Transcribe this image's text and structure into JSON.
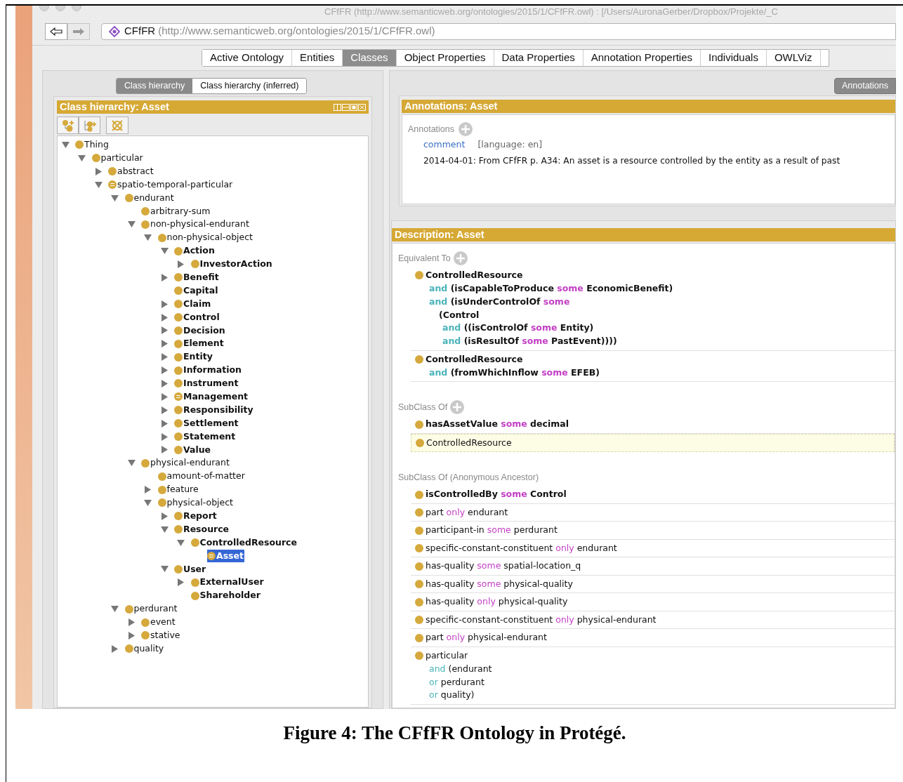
{
  "window": {
    "title": "CFfFR (http://www.semanticweb.org/ontologies/2015/1/CFfFR.owl)  : [/Users/AuronaGerber/Dropbox/Projekte/_C"
  },
  "address": {
    "name": "CFfFR",
    "iri": "(http://www.semanticweb.org/ontologies/2015/1/CFfFR.owl)"
  },
  "tabs": [
    {
      "label": "Active Ontology",
      "selected": false
    },
    {
      "label": "Entities",
      "selected": false
    },
    {
      "label": "Classes",
      "selected": true
    },
    {
      "label": "Object Properties",
      "selected": false
    },
    {
      "label": "Data Properties",
      "selected": false
    },
    {
      "label": "Annotation Properties",
      "selected": false
    },
    {
      "label": "Individuals",
      "selected": false
    },
    {
      "label": "OWLViz",
      "selected": false
    }
  ],
  "class_hierarchy": {
    "view_tabs": [
      {
        "label": "Class hierarchy",
        "selected": true
      },
      {
        "label": "Class hierarchy (inferred)",
        "selected": false
      }
    ],
    "title": "Class hierarchy: Asset",
    "tree": [
      {
        "label": "Thing",
        "kind": "branch",
        "expanded": true,
        "bold": false,
        "defined": false,
        "selected": false,
        "children": [
          {
            "label": "particular",
            "kind": "branch",
            "expanded": true,
            "bold": false,
            "defined": false,
            "selected": false,
            "children": [
              {
                "label": "abstract",
                "kind": "branch",
                "expanded": false,
                "bold": false,
                "defined": false,
                "selected": false
              },
              {
                "label": "spatio-temporal-particular",
                "kind": "branch",
                "expanded": true,
                "bold": false,
                "defined": true,
                "selected": false,
                "children": [
                  {
                    "label": "endurant",
                    "kind": "branch",
                    "expanded": true,
                    "bold": false,
                    "defined": false,
                    "selected": false,
                    "children": [
                      {
                        "label": "arbitrary-sum",
                        "kind": "leaf",
                        "bold": false,
                        "defined": false,
                        "selected": false
                      },
                      {
                        "label": "non-physical-endurant",
                        "kind": "branch",
                        "expanded": true,
                        "bold": false,
                        "defined": false,
                        "selected": false,
                        "children": [
                          {
                            "label": "non-physical-object",
                            "kind": "branch",
                            "expanded": true,
                            "bold": false,
                            "defined": false,
                            "selected": false,
                            "children": [
                              {
                                "label": "Action",
                                "kind": "branch",
                                "expanded": true,
                                "bold": true,
                                "defined": false,
                                "selected": false,
                                "children": [
                                  {
                                    "label": "InvestorAction",
                                    "kind": "branch",
                                    "expanded": false,
                                    "bold": true,
                                    "defined": false,
                                    "selected": false
                                  }
                                ]
                              },
                              {
                                "label": "Benefit",
                                "kind": "branch",
                                "expanded": false,
                                "bold": true,
                                "defined": false,
                                "selected": false
                              },
                              {
                                "label": "Capital",
                                "kind": "leaf",
                                "bold": true,
                                "defined": false,
                                "selected": false
                              },
                              {
                                "label": "Claim",
                                "kind": "branch",
                                "expanded": false,
                                "bold": true,
                                "defined": false,
                                "selected": false
                              },
                              {
                                "label": "Control",
                                "kind": "branch",
                                "expanded": false,
                                "bold": true,
                                "defined": false,
                                "selected": false
                              },
                              {
                                "label": "Decision",
                                "kind": "branch",
                                "expanded": false,
                                "bold": true,
                                "defined": false,
                                "selected": false
                              },
                              {
                                "label": "Element",
                                "kind": "branch",
                                "expanded": false,
                                "bold": true,
                                "defined": false,
                                "selected": false
                              },
                              {
                                "label": "Entity",
                                "kind": "branch",
                                "expanded": false,
                                "bold": true,
                                "defined": false,
                                "selected": false
                              },
                              {
                                "label": "Information",
                                "kind": "branch",
                                "expanded": false,
                                "bold": true,
                                "defined": false,
                                "selected": false
                              },
                              {
                                "label": "Instrument",
                                "kind": "branch",
                                "expanded": false,
                                "bold": true,
                                "defined": false,
                                "selected": false
                              },
                              {
                                "label": "Management",
                                "kind": "branch",
                                "expanded": false,
                                "bold": true,
                                "defined": true,
                                "selected": false
                              },
                              {
                                "label": "Responsibility",
                                "kind": "branch",
                                "expanded": false,
                                "bold": true,
                                "defined": false,
                                "selected": false
                              },
                              {
                                "label": "Settlement",
                                "kind": "branch",
                                "expanded": false,
                                "bold": true,
                                "defined": false,
                                "selected": false
                              },
                              {
                                "label": "Statement",
                                "kind": "branch",
                                "expanded": false,
                                "bold": true,
                                "defined": false,
                                "selected": false
                              },
                              {
                                "label": "Value",
                                "kind": "branch",
                                "expanded": false,
                                "bold": true,
                                "defined": false,
                                "selected": false
                              }
                            ]
                          }
                        ]
                      },
                      {
                        "label": "physical-endurant",
                        "kind": "branch",
                        "expanded": true,
                        "bold": false,
                        "defined": false,
                        "selected": false,
                        "children": [
                          {
                            "label": "amount-of-matter",
                            "kind": "leaf",
                            "bold": false,
                            "defined": false,
                            "selected": false
                          },
                          {
                            "label": "feature",
                            "kind": "branch",
                            "expanded": false,
                            "bold": false,
                            "defined": false,
                            "selected": false
                          },
                          {
                            "label": "physical-object",
                            "kind": "branch",
                            "expanded": true,
                            "bold": false,
                            "defined": false,
                            "selected": false,
                            "children": [
                              {
                                "label": "Report",
                                "kind": "branch",
                                "expanded": false,
                                "bold": true,
                                "defined": false,
                                "selected": false
                              },
                              {
                                "label": "Resource",
                                "kind": "branch",
                                "expanded": true,
                                "bold": true,
                                "defined": false,
                                "selected": false,
                                "children": [
                                  {
                                    "label": "ControlledResource",
                                    "kind": "branch",
                                    "expanded": true,
                                    "bold": true,
                                    "defined": false,
                                    "selected": false,
                                    "children": [
                                      {
                                        "label": "Asset",
                                        "kind": "leaf",
                                        "bold": true,
                                        "defined": true,
                                        "selected": true
                                      }
                                    ]
                                  }
                                ]
                              },
                              {
                                "label": "User",
                                "kind": "branch",
                                "expanded": true,
                                "bold": true,
                                "defined": false,
                                "selected": false,
                                "children": [
                                  {
                                    "label": "ExternalUser",
                                    "kind": "branch",
                                    "expanded": false,
                                    "bold": true,
                                    "defined": false,
                                    "selected": false
                                  },
                                  {
                                    "label": "Shareholder",
                                    "kind": "leaf",
                                    "bold": true,
                                    "defined": false,
                                    "selected": false
                                  }
                                ]
                              }
                            ]
                          }
                        ]
                      }
                    ]
                  },
                  {
                    "label": "perdurant",
                    "kind": "branch",
                    "expanded": true,
                    "bold": false,
                    "defined": false,
                    "selected": false,
                    "children": [
                      {
                        "label": "event",
                        "kind": "branch",
                        "expanded": false,
                        "bold": false,
                        "defined": false,
                        "selected": false
                      },
                      {
                        "label": "stative",
                        "kind": "branch",
                        "expanded": false,
                        "bold": false,
                        "defined": false,
                        "selected": false
                      }
                    ]
                  },
                  {
                    "label": "quality",
                    "kind": "branch",
                    "expanded": false,
                    "bold": false,
                    "defined": false,
                    "selected": false
                  }
                ]
              }
            ]
          }
        ]
      }
    ]
  },
  "annotations": {
    "button": "Annotations",
    "title": "Annotations: Asset",
    "section_label": "Annotations",
    "items": [
      {
        "property": "comment",
        "language": "[language: en]",
        "value": "2014-04-01: From CFfFR p. A34: An asset is a resource controlled by the entity as a result of past"
      }
    ]
  },
  "description": {
    "title": "Description: Asset",
    "sections": [
      {
        "label": "Equivalent To",
        "addable": true,
        "expressions": [
          {
            "bold": true,
            "selected": false,
            "lines": [
              {
                "segments": [
                  {
                    "text": "ControlledResource",
                    "kind": "name"
                  }
                ],
                "children": [
                  {
                    "segments": [
                      {
                        "text": "and",
                        "kind": "connective"
                      },
                      {
                        "text": " (isCapableToProduce ",
                        "kind": "name"
                      },
                      {
                        "text": "some",
                        "kind": "quantifier"
                      },
                      {
                        "text": " EconomicBenefit)",
                        "kind": "name"
                      }
                    ]
                  },
                  {
                    "segments": [
                      {
                        "text": "and",
                        "kind": "connective"
                      },
                      {
                        "text": " (isUnderControlOf ",
                        "kind": "name"
                      },
                      {
                        "text": "some",
                        "kind": "quantifier"
                      }
                    ],
                    "children": [
                      {
                        "segments": [
                          {
                            "text": "(Control",
                            "kind": "name"
                          }
                        ],
                        "children": [
                          {
                            "segments": [
                              {
                                "text": "and",
                                "kind": "connective"
                              },
                              {
                                "text": " ((isControlOf ",
                                "kind": "name"
                              },
                              {
                                "text": "some",
                                "kind": "quantifier"
                              },
                              {
                                "text": " Entity)",
                                "kind": "name"
                              }
                            ]
                          },
                          {
                            "segments": [
                              {
                                "text": "and",
                                "kind": "connective"
                              },
                              {
                                "text": " (isResultOf ",
                                "kind": "name"
                              },
                              {
                                "text": "some",
                                "kind": "quantifier"
                              },
                              {
                                "text": " PastEvent))))",
                                "kind": "name"
                              }
                            ]
                          }
                        ]
                      }
                    ]
                  }
                ]
              }
            ]
          },
          {
            "bold": true,
            "selected": false,
            "lines": [
              {
                "segments": [
                  {
                    "text": "ControlledResource",
                    "kind": "name"
                  }
                ],
                "children": [
                  {
                    "segments": [
                      {
                        "text": "and",
                        "kind": "connective"
                      },
                      {
                        "text": " (fromWhichInflow ",
                        "kind": "name"
                      },
                      {
                        "text": "some",
                        "kind": "quantifier"
                      },
                      {
                        "text": " EFEB)",
                        "kind": "name"
                      }
                    ]
                  }
                ]
              }
            ]
          }
        ]
      },
      {
        "label": "SubClass Of",
        "addable": true,
        "expressions": [
          {
            "bold": true,
            "selected": false,
            "lines": [
              {
                "segments": [
                  {
                    "text": "hasAssetValue ",
                    "kind": "name"
                  },
                  {
                    "text": "some",
                    "kind": "quantifier"
                  },
                  {
                    "text": " decimal",
                    "kind": "name"
                  }
                ]
              }
            ]
          },
          {
            "bold": false,
            "selected": true,
            "lines": [
              {
                "segments": [
                  {
                    "text": "ControlledResource",
                    "kind": "name"
                  }
                ]
              }
            ]
          }
        ]
      },
      {
        "label": "SubClass Of (Anonymous Ancestor)",
        "addable": false,
        "expressions": [
          {
            "bold": true,
            "selected": false,
            "lines": [
              {
                "segments": [
                  {
                    "text": "isControlledBy ",
                    "kind": "name"
                  },
                  {
                    "text": "some",
                    "kind": "quantifier"
                  },
                  {
                    "text": " Control",
                    "kind": "name"
                  }
                ]
              }
            ]
          },
          {
            "bold": false,
            "selected": false,
            "lines": [
              {
                "segments": [
                  {
                    "text": "part ",
                    "kind": "name"
                  },
                  {
                    "text": "only",
                    "kind": "quantifier"
                  },
                  {
                    "text": " endurant",
                    "kind": "name"
                  }
                ]
              }
            ]
          },
          {
            "bold": false,
            "selected": false,
            "lines": [
              {
                "segments": [
                  {
                    "text": "participant-in ",
                    "kind": "name"
                  },
                  {
                    "text": "some",
                    "kind": "quantifier"
                  },
                  {
                    "text": " perdurant",
                    "kind": "name"
                  }
                ]
              }
            ]
          },
          {
            "bold": false,
            "selected": false,
            "lines": [
              {
                "segments": [
                  {
                    "text": "specific-constant-constituent ",
                    "kind": "name"
                  },
                  {
                    "text": "only",
                    "kind": "quantifier"
                  },
                  {
                    "text": " endurant",
                    "kind": "name"
                  }
                ]
              }
            ]
          },
          {
            "bold": false,
            "selected": false,
            "lines": [
              {
                "segments": [
                  {
                    "text": "has-quality ",
                    "kind": "name"
                  },
                  {
                    "text": "some",
                    "kind": "quantifier"
                  },
                  {
                    "text": " spatial-location_q",
                    "kind": "name"
                  }
                ]
              }
            ]
          },
          {
            "bold": false,
            "selected": false,
            "lines": [
              {
                "segments": [
                  {
                    "text": "has-quality ",
                    "kind": "name"
                  },
                  {
                    "text": "some",
                    "kind": "quantifier"
                  },
                  {
                    "text": " physical-quality",
                    "kind": "name"
                  }
                ]
              }
            ]
          },
          {
            "bold": false,
            "selected": false,
            "lines": [
              {
                "segments": [
                  {
                    "text": "has-quality ",
                    "kind": "name"
                  },
                  {
                    "text": "only",
                    "kind": "quantifier"
                  },
                  {
                    "text": " physical-quality",
                    "kind": "name"
                  }
                ]
              }
            ]
          },
          {
            "bold": false,
            "selected": false,
            "lines": [
              {
                "segments": [
                  {
                    "text": "specific-constant-constituent ",
                    "kind": "name"
                  },
                  {
                    "text": "only",
                    "kind": "quantifier"
                  },
                  {
                    "text": " physical-endurant",
                    "kind": "name"
                  }
                ]
              }
            ]
          },
          {
            "bold": false,
            "selected": false,
            "lines": [
              {
                "segments": [
                  {
                    "text": "part ",
                    "kind": "name"
                  },
                  {
                    "text": "only",
                    "kind": "quantifier"
                  },
                  {
                    "text": " physical-endurant",
                    "kind": "name"
                  }
                ]
              }
            ]
          },
          {
            "bold": false,
            "selected": false,
            "lines": [
              {
                "segments": [
                  {
                    "text": "particular",
                    "kind": "name"
                  }
                ],
                "children": [
                  {
                    "segments": [
                      {
                        "text": "and",
                        "kind": "connective"
                      },
                      {
                        "text": " (endurant",
                        "kind": "name"
                      }
                    ]
                  },
                  {
                    "segments": [
                      {
                        "text": "or",
                        "kind": "connective"
                      },
                      {
                        "text": " perdurant",
                        "kind": "name"
                      }
                    ]
                  },
                  {
                    "segments": [
                      {
                        "text": "or",
                        "kind": "connective"
                      },
                      {
                        "text": " quality)",
                        "kind": "name"
                      }
                    ]
                  }
                ]
              }
            ]
          }
        ]
      }
    ]
  },
  "caption": "Figure 4: The CFfFR Ontology in Protégé."
}
